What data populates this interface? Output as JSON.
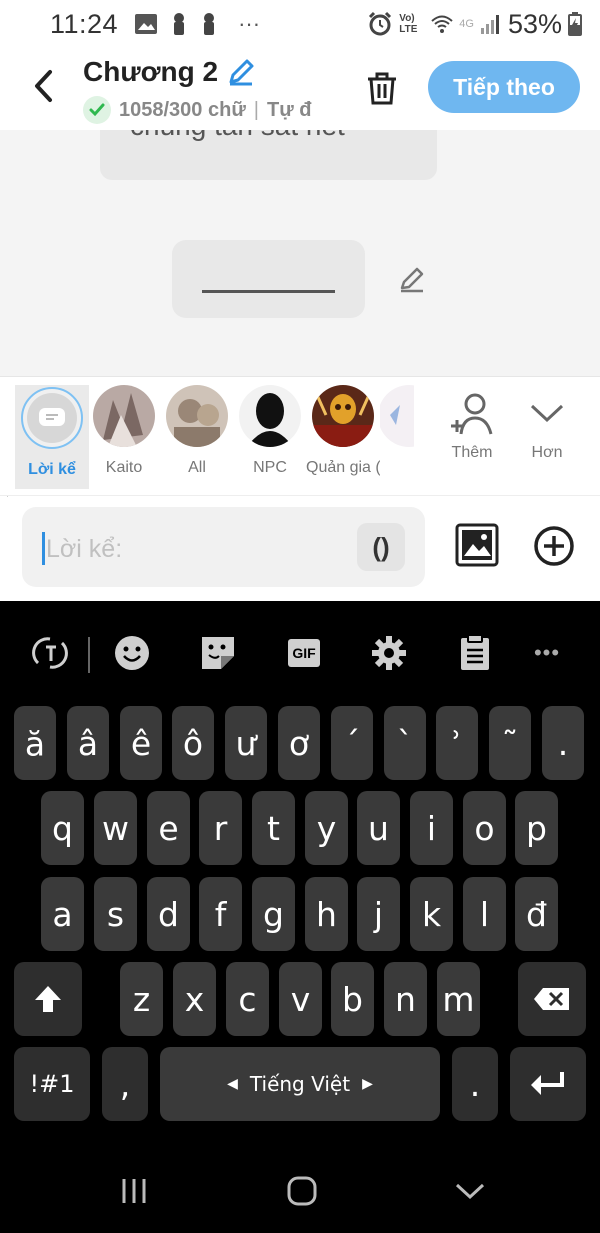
{
  "status_bar": {
    "time": "11:24",
    "network": "Vo) LTE",
    "signal_type": "4G",
    "battery": "53%"
  },
  "header": {
    "title": "Chương 2",
    "word_count": "1058/300 chữ",
    "separator": "|",
    "autosave": "Tự đ",
    "next_button": "Tiếp theo"
  },
  "chat": {
    "bubble_text": "chúng tần sát hết"
  },
  "characters": [
    {
      "name": "Lời kể",
      "selected": true
    },
    {
      "name": "Kaito",
      "selected": false
    },
    {
      "name": "All",
      "selected": false
    },
    {
      "name": "NPC",
      "selected": false
    },
    {
      "name": "Quản gia (..ily",
      "selected": false
    }
  ],
  "actions": {
    "add": "Thêm",
    "more": "Hơn"
  },
  "composer": {
    "placeholder": "Lời kể:",
    "paren_button": "()"
  },
  "keyboard": {
    "row1": [
      "ă",
      "â",
      "ê",
      "ô",
      "ư",
      "ơ",
      "´",
      "`",
      "̉",
      "˜",
      "."
    ],
    "row2": [
      "q",
      "w",
      "e",
      "r",
      "t",
      "y",
      "u",
      "i",
      "o",
      "p"
    ],
    "row3": [
      "a",
      "s",
      "d",
      "f",
      "g",
      "h",
      "j",
      "k",
      "l",
      "đ"
    ],
    "row4": [
      "z",
      "x",
      "c",
      "v",
      "b",
      "n",
      "m"
    ],
    "symbols": "!#1",
    "comma": ",",
    "space_label": "Tiếng Việt",
    "period": ".",
    "gif": "GIF"
  },
  "colors": {
    "accent": "#6fb7f0",
    "selected_label": "#2f8fe0",
    "keyboard_bg": "#000000",
    "key_bg": "#3a3a3a"
  }
}
